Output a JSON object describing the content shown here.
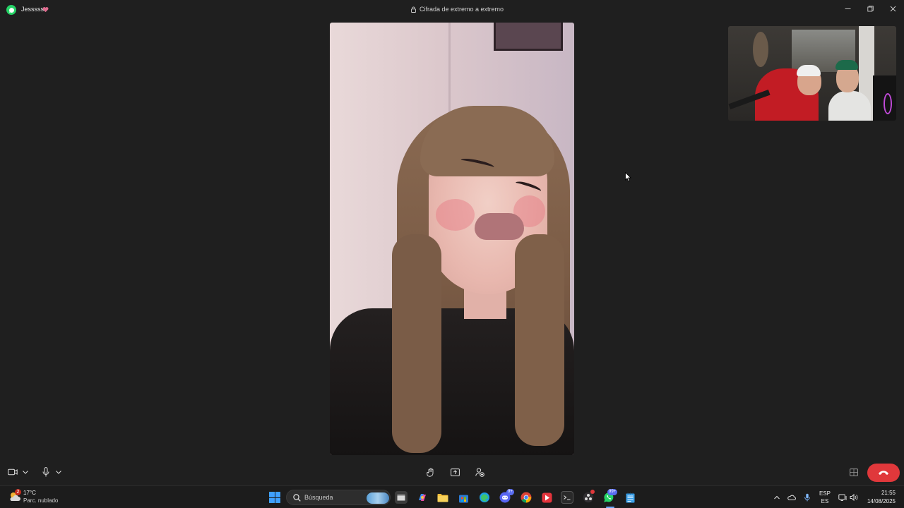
{
  "window": {
    "contact_name": "Jessssss",
    "encryption_label": "Cifrada de extremo a extremo",
    "icons": {
      "app": "whatsapp-icon",
      "heart": "heart-icon",
      "lock": "lock-icon",
      "minimize": "minimize-icon",
      "maximize": "maximize-icon",
      "close": "close-icon"
    }
  },
  "call": {
    "icons": {
      "camera": "video-camera-icon",
      "camera_menu": "chevron-down-icon",
      "mic": "microphone-icon",
      "mic_menu": "chevron-down-icon",
      "raise_hand": "raise-hand-icon",
      "share_screen": "share-screen-icon",
      "add_person": "add-person-icon",
      "layout": "layout-grid-icon",
      "end_call": "end-call-icon"
    },
    "colors": {
      "end_call": "#e0383b",
      "background": "#1f1f1f"
    }
  },
  "taskbar": {
    "weather": {
      "badge": "2",
      "temp": "17°C",
      "desc": "Parc. nublado"
    },
    "search": {
      "placeholder": "Búsqueda"
    },
    "apps": [
      {
        "name": "terminal-app",
        "badge": ""
      },
      {
        "name": "copilot-app",
        "badge": ""
      },
      {
        "name": "file-explorer-app",
        "badge": ""
      },
      {
        "name": "store-app",
        "badge": ""
      },
      {
        "name": "edge-app",
        "badge": ""
      },
      {
        "name": "discord-app",
        "badge": "9+"
      },
      {
        "name": "chrome-app",
        "badge": ""
      },
      {
        "name": "media-app",
        "badge": ""
      },
      {
        "name": "cmd-app",
        "badge": ""
      },
      {
        "name": "obs-app",
        "badge": ""
      },
      {
        "name": "whatsapp-app",
        "badge": "99+"
      },
      {
        "name": "notepad-app",
        "badge": ""
      }
    ],
    "tray": {
      "lang_top": "ESP",
      "lang_bottom": "ES",
      "time": "21:55",
      "date": "14/08/2025"
    }
  }
}
